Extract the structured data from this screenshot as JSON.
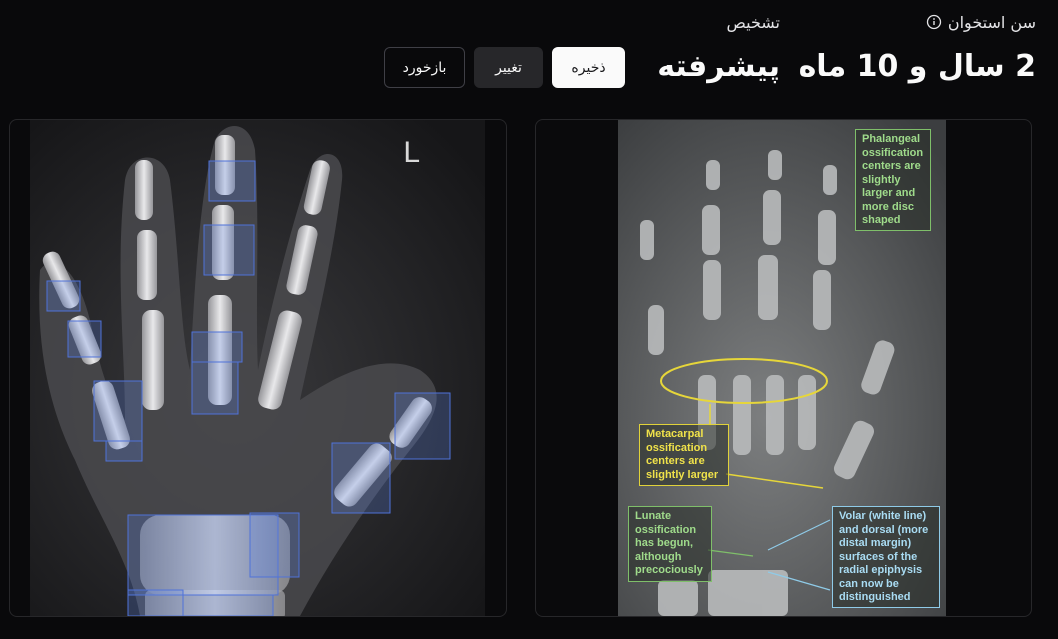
{
  "header": {
    "bone_age_label": "سن استخوان",
    "bone_age_value": "2 سال و 10 ماه",
    "diagnosis_label": "تشخیص",
    "diagnosis_value": "پیشرفته"
  },
  "buttons": {
    "save": "ذخیره",
    "change": "تغییر",
    "feedback": "بازخورد"
  },
  "left_image": {
    "marker": "L"
  },
  "right_image": {
    "annotations": {
      "phalangeal": "Phalangeal ossification centers are slightly larger and more disc shaped",
      "metacarpal": "Metacarpal ossification centers are slightly larger",
      "lunate": "Lunate ossification has begun, although precociously",
      "volar": "Volar (white line) and dorsal (more distal margin) surfaces of the radial epiphysis can now be distinguished"
    }
  },
  "colors": {
    "background": "#09090b",
    "primary_button": "#fafafa",
    "secondary_button": "#27272a",
    "detection_box": "#4f72d9",
    "annotation_green": "#9fdb8b",
    "annotation_yellow": "#f0e24a",
    "annotation_blue": "#a9dcf3"
  },
  "icons": {
    "info": "info-circle-icon"
  }
}
